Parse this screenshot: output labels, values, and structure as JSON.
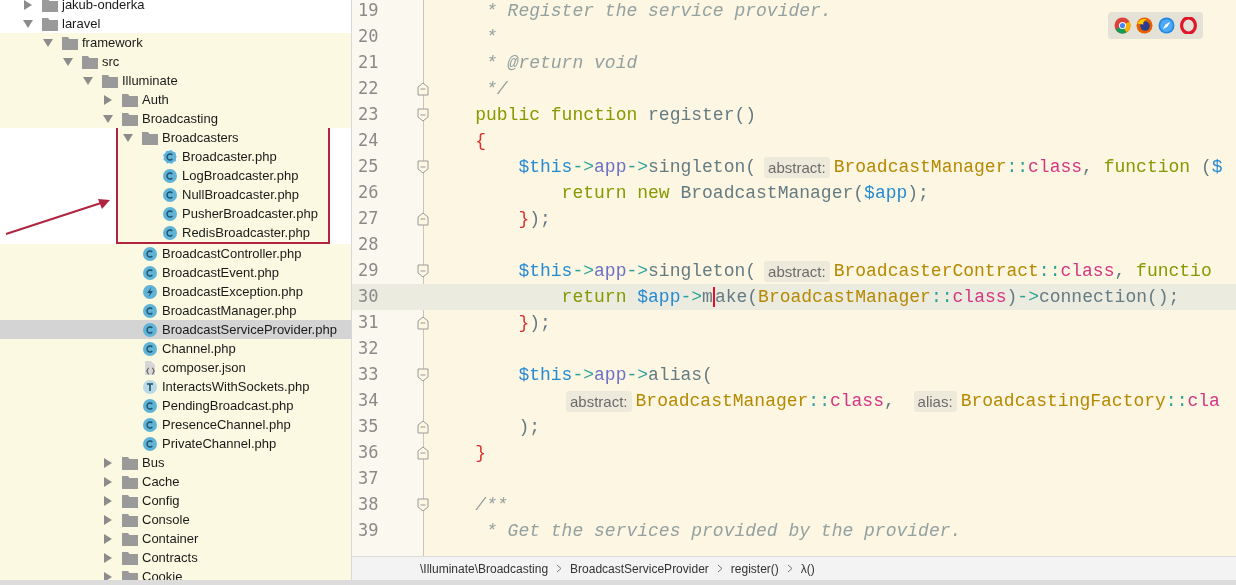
{
  "project_tree": [
    {
      "label": "jakub-onderka",
      "kind": "folder",
      "expanded": false,
      "selected": false
    },
    {
      "label": "laravel",
      "kind": "folder",
      "expanded": true,
      "selected": false,
      "children": [
        {
          "label": "framework",
          "kind": "folder",
          "expanded": true,
          "selected": false,
          "children": [
            {
              "label": "src",
              "kind": "folder",
              "expanded": true,
              "selected": false,
              "children": [
                {
                  "label": "Illuminate",
                  "kind": "folder",
                  "expanded": true,
                  "selected": false,
                  "children": [
                    {
                      "label": "Auth",
                      "kind": "folder",
                      "expanded": false,
                      "selected": false
                    },
                    {
                      "label": "Broadcasting",
                      "kind": "folder",
                      "expanded": true,
                      "selected": false,
                      "children": [
                        {
                          "label": "Broadcasters",
                          "kind": "folder",
                          "expanded": true,
                          "selected": false,
                          "boxed": true,
                          "children": [
                            {
                              "label": "Broadcaster.php",
                              "kind": "interface",
                              "selected": false
                            },
                            {
                              "label": "LogBroadcaster.php",
                              "kind": "class",
                              "selected": false
                            },
                            {
                              "label": "NullBroadcaster.php",
                              "kind": "class",
                              "selected": false
                            },
                            {
                              "label": "PusherBroadcaster.php",
                              "kind": "class",
                              "selected": false
                            },
                            {
                              "label": "RedisBroadcaster.php",
                              "kind": "class",
                              "selected": false
                            }
                          ]
                        },
                        {
                          "label": "BroadcastController.php",
                          "kind": "class",
                          "selected": false
                        },
                        {
                          "label": "BroadcastEvent.php",
                          "kind": "class",
                          "selected": false
                        },
                        {
                          "label": "BroadcastException.php",
                          "kind": "exception",
                          "selected": false
                        },
                        {
                          "label": "BroadcastManager.php",
                          "kind": "class",
                          "selected": false
                        },
                        {
                          "label": "BroadcastServiceProvider.php",
                          "kind": "class",
                          "selected": true
                        },
                        {
                          "label": "Channel.php",
                          "kind": "class",
                          "selected": false
                        },
                        {
                          "label": "composer.json",
                          "kind": "json",
                          "selected": false
                        },
                        {
                          "label": "InteractsWithSockets.php",
                          "kind": "trait",
                          "selected": false
                        },
                        {
                          "label": "PendingBroadcast.php",
                          "kind": "class",
                          "selected": false
                        },
                        {
                          "label": "PresenceChannel.php",
                          "kind": "class",
                          "selected": false
                        },
                        {
                          "label": "PrivateChannel.php",
                          "kind": "class",
                          "selected": false
                        }
                      ]
                    },
                    {
                      "label": "Bus",
                      "kind": "folder",
                      "expanded": false,
                      "selected": false
                    },
                    {
                      "label": "Cache",
                      "kind": "folder",
                      "expanded": false,
                      "selected": false
                    },
                    {
                      "label": "Config",
                      "kind": "folder",
                      "expanded": false,
                      "selected": false
                    },
                    {
                      "label": "Console",
                      "kind": "folder",
                      "expanded": false,
                      "selected": false
                    },
                    {
                      "label": "Container",
                      "kind": "folder",
                      "expanded": false,
                      "selected": false
                    },
                    {
                      "label": "Contracts",
                      "kind": "folder",
                      "expanded": false,
                      "selected": false
                    },
                    {
                      "label": "Cookie",
                      "kind": "folder",
                      "expanded": false,
                      "selected": false
                    }
                  ]
                }
              ]
            }
          ]
        }
      ]
    }
  ],
  "editor": {
    "lines": [
      {
        "number": "19",
        "current": false,
        "fold_start": false,
        "fold_end": false,
        "tokens": [
          {
            "kind": "comment",
            "text": "     * Register the service provider."
          }
        ]
      },
      {
        "number": "20",
        "current": false,
        "fold_start": false,
        "fold_end": false,
        "tokens": [
          {
            "kind": "comment",
            "text": "     *"
          }
        ]
      },
      {
        "number": "21",
        "current": false,
        "fold_start": false,
        "fold_end": false,
        "tokens": [
          {
            "kind": "comment",
            "text": "     * @return void"
          }
        ]
      },
      {
        "number": "22",
        "current": false,
        "fold_start": false,
        "fold_end": true,
        "tokens": [
          {
            "kind": "comment",
            "text": "     */"
          }
        ]
      },
      {
        "number": "23",
        "current": false,
        "fold_start": true,
        "fold_end": false,
        "tokens": [
          {
            "kind": "keyword",
            "text": "    public function"
          },
          {
            "kind": "plain",
            "text": " register()"
          }
        ]
      },
      {
        "number": "24",
        "current": false,
        "fold_start": false,
        "fold_end": false,
        "tokens": [
          {
            "kind": "brace",
            "text": "    {"
          }
        ]
      },
      {
        "number": "25",
        "current": false,
        "fold_start": true,
        "fold_end": false,
        "tokens": [
          {
            "kind": "var",
            "text": "        $this"
          },
          {
            "kind": "op",
            "text": "->"
          },
          {
            "kind": "prop",
            "text": "app"
          },
          {
            "kind": "op",
            "text": "->"
          },
          {
            "kind": "plain",
            "text": "singleton("
          },
          {
            "kind": "hint",
            "text": "abstract:"
          },
          {
            "kind": "class",
            "text": "BroadcastManager"
          },
          {
            "kind": "op",
            "text": "::"
          },
          {
            "kind": "magic",
            "text": "class"
          },
          {
            "kind": "plain",
            "text": ", "
          },
          {
            "kind": "keyword",
            "text": "function"
          },
          {
            "kind": "plain",
            "text": " ("
          },
          {
            "kind": "var",
            "text": "$"
          }
        ]
      },
      {
        "number": "26",
        "current": false,
        "fold_start": false,
        "fold_end": false,
        "tokens": [
          {
            "kind": "keyword",
            "text": "            return new"
          },
          {
            "kind": "plain",
            "text": " BroadcastManager("
          },
          {
            "kind": "var",
            "text": "$app"
          },
          {
            "kind": "plain",
            "text": ");"
          }
        ]
      },
      {
        "number": "27",
        "current": false,
        "fold_start": false,
        "fold_end": true,
        "tokens": [
          {
            "kind": "brace",
            "text": "        }"
          },
          {
            "kind": "plain",
            "text": ");"
          }
        ]
      },
      {
        "number": "28",
        "current": false,
        "fold_start": false,
        "fold_end": false
      },
      {
        "number": "29",
        "current": false,
        "fold_start": true,
        "fold_end": false,
        "tokens": [
          {
            "kind": "var",
            "text": "        $this"
          },
          {
            "kind": "op",
            "text": "->"
          },
          {
            "kind": "prop",
            "text": "app"
          },
          {
            "kind": "op",
            "text": "->"
          },
          {
            "kind": "plain",
            "text": "singleton("
          },
          {
            "kind": "hint",
            "text": "abstract:"
          },
          {
            "kind": "class",
            "text": "BroadcasterContract"
          },
          {
            "kind": "op",
            "text": "::"
          },
          {
            "kind": "magic",
            "text": "class"
          },
          {
            "kind": "plain",
            "text": ", "
          },
          {
            "kind": "keyword",
            "text": "functio"
          }
        ]
      },
      {
        "number": "30",
        "current": true,
        "fold_start": false,
        "fold_end": false,
        "tokens": [
          {
            "kind": "keyword",
            "text": "            return"
          },
          {
            "kind": "var",
            "text": " $app"
          },
          {
            "kind": "op",
            "text": "->"
          },
          {
            "kind": "plain",
            "text": "m"
          },
          {
            "kind": "caret"
          },
          {
            "kind": "plain",
            "text": "ake("
          },
          {
            "kind": "class",
            "text": "BroadcastManager"
          },
          {
            "kind": "op",
            "text": "::"
          },
          {
            "kind": "magic",
            "text": "class"
          },
          {
            "kind": "plain",
            "text": ")"
          },
          {
            "kind": "op",
            "text": "->"
          },
          {
            "kind": "plain",
            "text": "connection();"
          }
        ]
      },
      {
        "number": "31",
        "current": false,
        "fold_start": false,
        "fold_end": true,
        "tokens": [
          {
            "kind": "brace",
            "text": "        }"
          },
          {
            "kind": "plain",
            "text": ");"
          }
        ]
      },
      {
        "number": "32",
        "current": false,
        "fold_start": false,
        "fold_end": false
      },
      {
        "number": "33",
        "current": false,
        "fold_start": true,
        "fold_end": false,
        "tokens": [
          {
            "kind": "var",
            "text": "        $this"
          },
          {
            "kind": "op",
            "text": "->"
          },
          {
            "kind": "prop",
            "text": "app"
          },
          {
            "kind": "op",
            "text": "->"
          },
          {
            "kind": "plain",
            "text": "alias("
          }
        ]
      },
      {
        "number": "34",
        "current": false,
        "fold_start": false,
        "fold_end": false,
        "tokens": [
          {
            "kind": "hint",
            "text": "abstract:"
          },
          {
            "kind": "class",
            "text": "BroadcastManager"
          },
          {
            "kind": "op",
            "text": "::"
          },
          {
            "kind": "magic",
            "text": "class"
          },
          {
            "kind": "plain",
            "text": ", "
          },
          {
            "kind": "hint",
            "text": "alias:"
          },
          {
            "kind": "class",
            "text": "BroadcastingFactory"
          },
          {
            "kind": "op",
            "text": "::"
          },
          {
            "kind": "magic",
            "text": "cla"
          }
        ]
      },
      {
        "number": "35",
        "current": false,
        "fold_start": false,
        "fold_end": true,
        "tokens": [
          {
            "kind": "plain",
            "text": "        );"
          }
        ]
      },
      {
        "number": "36",
        "current": false,
        "fold_start": false,
        "fold_end": true,
        "tokens": [
          {
            "kind": "brace",
            "text": "    }"
          }
        ]
      },
      {
        "number": "37",
        "current": false,
        "fold_start": false,
        "fold_end": false
      },
      {
        "number": "38",
        "current": false,
        "fold_start": true,
        "fold_end": false,
        "tokens": [
          {
            "kind": "comment",
            "text": "    /**"
          }
        ]
      },
      {
        "number": "39",
        "current": false,
        "fold_start": false,
        "fold_end": false,
        "tokens": [
          {
            "kind": "comment",
            "text": "     * Get the services provided by the provider."
          }
        ]
      }
    ]
  },
  "breadcrumb": [
    "\\Illuminate\\Broadcasting",
    "BroadcastServiceProvider",
    "register()",
    "λ()"
  ]
}
